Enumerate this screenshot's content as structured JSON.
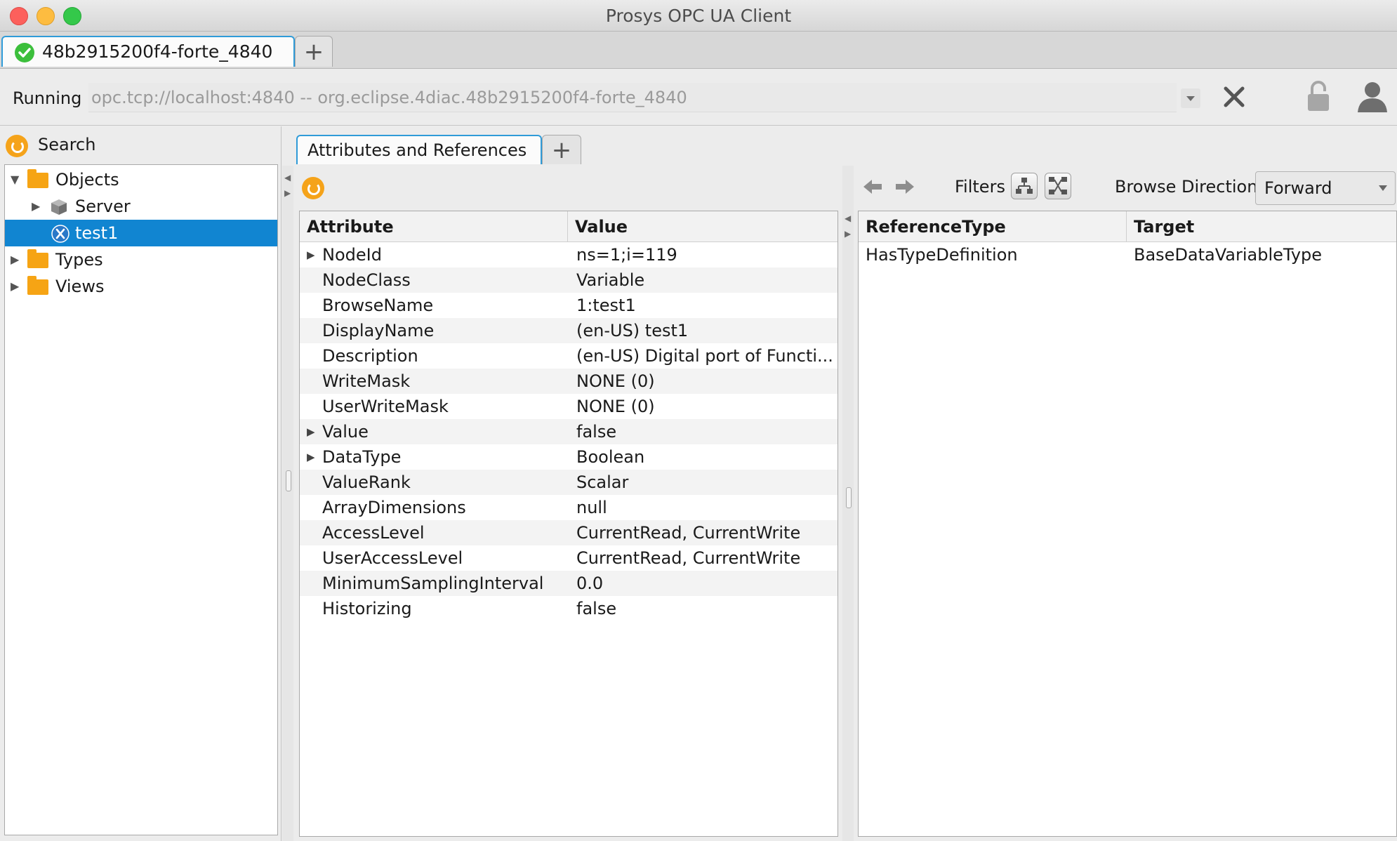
{
  "window": {
    "title": "Prosys OPC UA Client"
  },
  "connection_tabs": [
    {
      "label": "48b2915200f4-forte_4840"
    }
  ],
  "plus_glyph": "+",
  "connection": {
    "status": "Running",
    "address": "opc.tcp://localhost:4840 -- org.eclipse.4diac.48b2915200f4-forte_4840"
  },
  "sidebar": {
    "search_label": "Search",
    "tree": [
      {
        "label": "Objects",
        "expanded": true
      },
      {
        "label": "Server"
      },
      {
        "label": "test1",
        "selected": true
      },
      {
        "label": "Types"
      },
      {
        "label": "Views"
      }
    ]
  },
  "view_tabs": [
    {
      "label": "Attributes and References"
    }
  ],
  "attributes": {
    "columns": [
      "Attribute",
      "Value"
    ],
    "rows": [
      {
        "name": "NodeId",
        "value": "ns=1;i=119",
        "expandable": true
      },
      {
        "name": "NodeClass",
        "value": "Variable"
      },
      {
        "name": "BrowseName",
        "value": "1:test1"
      },
      {
        "name": "DisplayName",
        "value": "(en-US) test1"
      },
      {
        "name": "Description",
        "value": "(en-US) Digital port of Functi..."
      },
      {
        "name": "WriteMask",
        "value": "NONE  (0)"
      },
      {
        "name": "UserWriteMask",
        "value": "NONE  (0)"
      },
      {
        "name": "Value",
        "value": "false",
        "expandable": true
      },
      {
        "name": "DataType",
        "value": "Boolean",
        "expandable": true
      },
      {
        "name": "ValueRank",
        "value": "Scalar"
      },
      {
        "name": "ArrayDimensions",
        "value": "null"
      },
      {
        "name": "AccessLevel",
        "value": "CurrentRead, CurrentWrite"
      },
      {
        "name": "UserAccessLevel",
        "value": "CurrentRead, CurrentWrite"
      },
      {
        "name": "MinimumSamplingInterval",
        "value": "0.0"
      },
      {
        "name": "Historizing",
        "value": "false"
      }
    ]
  },
  "references": {
    "filters_label": "Filters",
    "browse_direction_label": "Browse Direction",
    "browse_direction_value": "Forward",
    "columns": [
      "ReferenceType",
      "Target"
    ],
    "rows": [
      {
        "type": "HasTypeDefinition",
        "target": "BaseDataVariableType"
      }
    ]
  },
  "colors": {
    "accent": "#2f9bd8",
    "selection": "#1185d1",
    "folder": "#f6a414",
    "refresh": "#f5a31a",
    "ok": "#3cbf3c"
  }
}
